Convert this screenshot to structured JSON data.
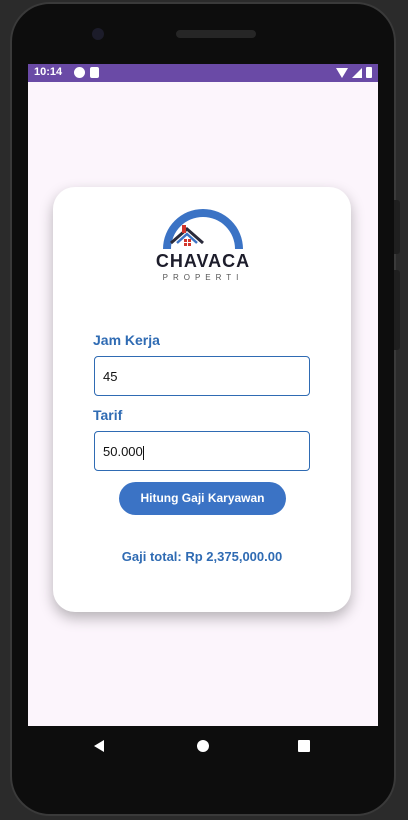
{
  "status_bar": {
    "time": "10:14"
  },
  "logo": {
    "name": "CHAVACA",
    "subtitle": "PROPERTI"
  },
  "form": {
    "jam_kerja_label": "Jam Kerja",
    "jam_kerja_value": "45",
    "tarif_label": "Tarif",
    "tarif_value": "50.000",
    "submit_label": "Hitung Gaji Karyawan"
  },
  "result": {
    "text": "Gaji total: Rp 2,375,000.00"
  },
  "colors": {
    "accent": "#3b73c5",
    "label": "#2f6bb3",
    "status_bar": "#6a4aa6",
    "background": "#fcf5fc"
  },
  "icons": {
    "nav_back": "back-triangle-icon",
    "nav_home": "home-circle-icon",
    "nav_recent": "recent-square-icon"
  }
}
